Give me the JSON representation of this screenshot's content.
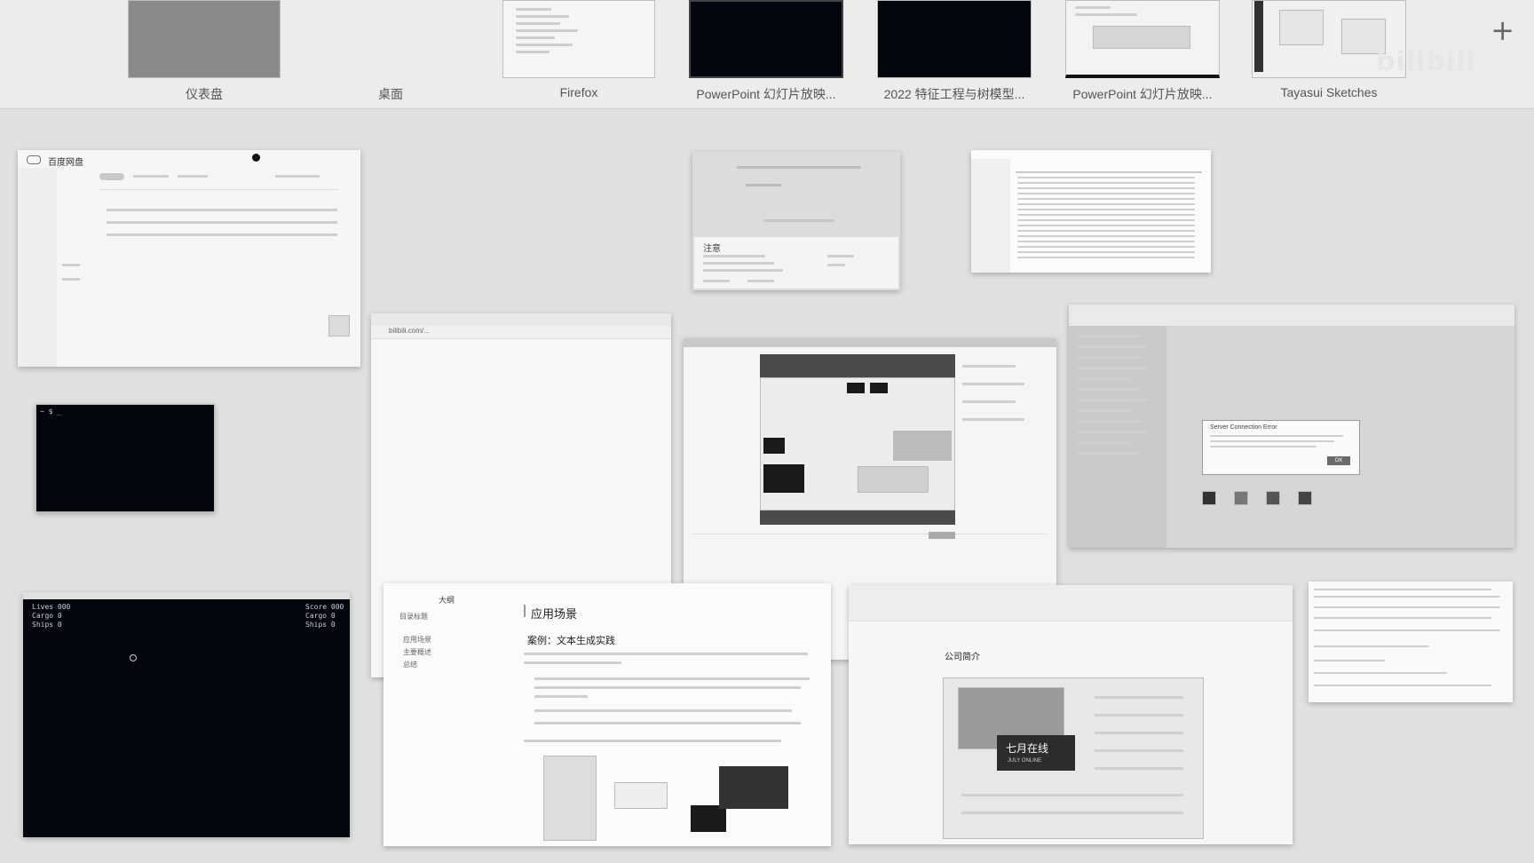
{
  "spaces": [
    {
      "label": "仪表盘"
    },
    {
      "label": "桌面"
    },
    {
      "label": "Firefox"
    },
    {
      "label": "PowerPoint 幻灯片放映..."
    },
    {
      "label": "2022 特征工程与树模型..."
    },
    {
      "label": "PowerPoint 幻灯片放映..."
    },
    {
      "label": "Tayasui Sketches"
    }
  ],
  "add_space_icon": "plus-icon",
  "watermark": "bilibili",
  "windows": {
    "netdisk": {
      "title": "百度网盘"
    },
    "dialog": {
      "heading": "注意"
    },
    "browser_blank": {
      "url": "bilibili.com/..."
    },
    "game": {
      "left_line1": "Lives 000",
      "left_line2": "Cargo 0",
      "left_line3": "Ships 0",
      "right_line1": "Score 000",
      "right_line2": "Cargo 0",
      "right_line3": "Ships 0"
    },
    "doc": {
      "outline_title": "大纲",
      "outline_items": [
        "目录标题",
        "应用场景",
        "主要概述",
        "总结"
      ],
      "heading": "应用场景",
      "subheading": "案例：文本生成实践"
    },
    "ppt_editor": {
      "slide_title": "公司简介",
      "badge_title": "七月在线",
      "badge_sub": "JULY ONLINE"
    },
    "vm_dialog": {
      "title": "Server Connection Error",
      "ok": "OK"
    }
  },
  "colors": {
    "desktop": "#e0e0e0",
    "spaces_bar": "#ececec",
    "dark_window": "#03050f"
  }
}
